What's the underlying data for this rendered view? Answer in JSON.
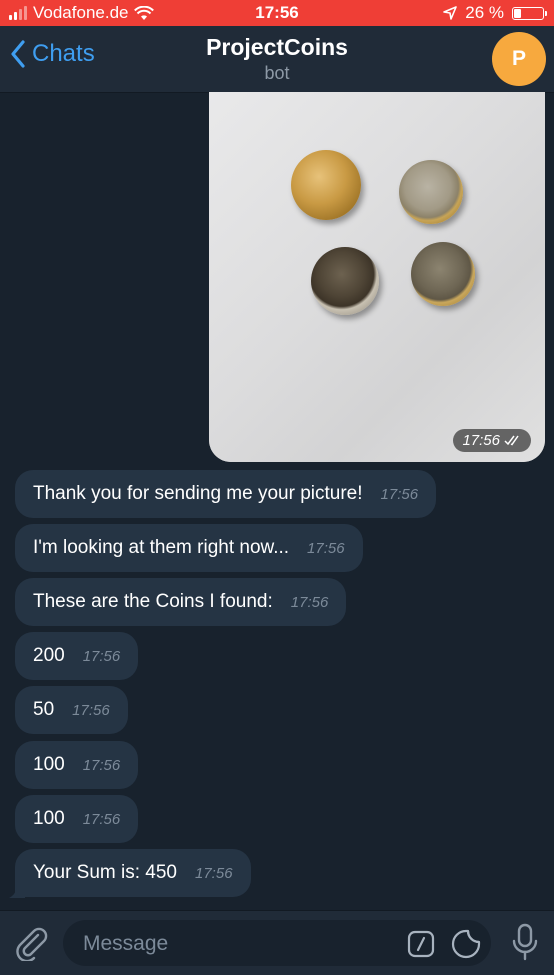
{
  "status_bar": {
    "carrier": "Vodafone.de",
    "time": "17:56",
    "battery": "26 %",
    "battery_level": 0.26
  },
  "header": {
    "back_label": "Chats",
    "title": "ProjectCoins",
    "subtitle": "bot",
    "avatar_letter": "P"
  },
  "photo_message": {
    "time": "17:56"
  },
  "messages": [
    {
      "text": "Thank you for sending me your picture!",
      "time": "17:56"
    },
    {
      "text": "I'm looking at them right now...",
      "time": "17:56"
    },
    {
      "text": "These are the Coins I found:",
      "time": "17:56"
    },
    {
      "text": "200",
      "time": "17:56"
    },
    {
      "text": "50",
      "time": "17:56"
    },
    {
      "text": "100",
      "time": "17:56"
    },
    {
      "text": "100",
      "time": "17:56"
    },
    {
      "text": "Your Sum is: 450",
      "time": "17:56"
    }
  ],
  "input": {
    "placeholder": "Message",
    "value": ""
  },
  "colors": {
    "status_bar": "#ef3e36",
    "background": "#18222d",
    "bubble": "#253444",
    "accent": "#3f9ef0",
    "avatar": "#f7a93e"
  },
  "icons": [
    "back-chevron-icon",
    "wifi-icon",
    "location-arrow-icon",
    "paperclip-icon",
    "bot-command-icon",
    "sticker-icon",
    "microphone-icon"
  ]
}
